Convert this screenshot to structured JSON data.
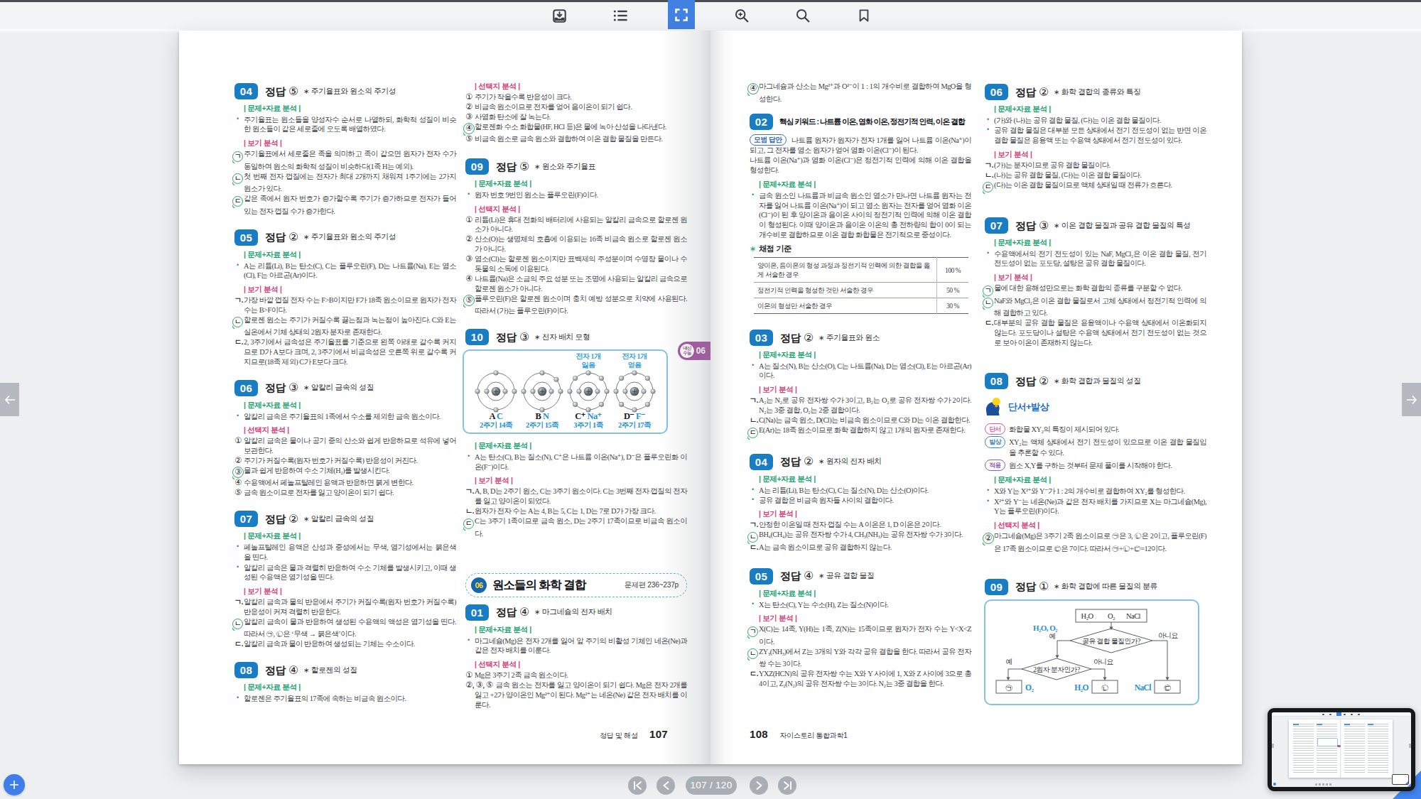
{
  "glyphs": {
    "star": "∗",
    "bullet": "•",
    "plus": "+",
    "left_arrow": "←",
    "right_arrow": "→",
    "pipe": "|"
  },
  "labels": {
    "answer": "정답"
  },
  "toolbar": {
    "items": [
      {
        "name": "download",
        "active": false
      },
      {
        "name": "toc",
        "active": false
      },
      {
        "name": "fullscreen",
        "active": true
      },
      {
        "name": "zoom-in",
        "active": false
      },
      {
        "name": "search",
        "active": false
      },
      {
        "name": "bookmark",
        "active": false
      }
    ]
  },
  "nav": {
    "indicator": "107 / 120",
    "buttons": [
      "first-page",
      "prev-page",
      "next-page",
      "last-page"
    ]
  },
  "left_page": {
    "footer": {
      "label": "정답 및 해설",
      "page": "107"
    },
    "sidetab": {
      "circle": [
        "내신",
        "수능"
      ],
      "num": "06"
    },
    "columns": [
      [
        {
          "type": "item",
          "num": "04",
          "ans": "⑤",
          "topic": "주기율표와 원소의 주기성",
          "blocks": [
            {
              "t": "g",
              "x": "문제+자료 분석"
            },
            {
              "t": "b",
              "x": "주기율표는 원소들을 양성자수 순서로 나열하되, 화학적 성질이 비슷한 원소들이 같은 세로줄에 오도록 배열하였다."
            },
            {
              "t": "p",
              "x": "보기 분석"
            },
            {
              "t": "m",
              "k": "ㄱ",
              "c": true,
              "x": "주기율표에서 세로줄은 족을 의미하고 족이 같으면 원자가 전자 수가 동일하여 원소의 화학적 성질이 비슷하다(1족 H는 예외)."
            },
            {
              "t": "m",
              "k": "ㄴ",
              "c": true,
              "x": "첫 번째 전자 껍질에는 전자가 최대 2개까지 채워져 1주기에는 2가지 원소가 있다."
            },
            {
              "t": "m",
              "k": "ㄷ",
              "c": true,
              "x": "같은 족에서 원자 번호가 증가할수록 주기가 증가하므로 전자가 들어 있는 전자 껍질 수가 증가한다."
            }
          ]
        },
        {
          "type": "item",
          "num": "05",
          "ans": "②",
          "topic": "주기율표와 원소의 주기성",
          "blocks": [
            {
              "t": "g",
              "x": "문제+자료 분석"
            },
            {
              "t": "b",
              "x": "A는 리튬(Li), B는 탄소(C), C는 플루오린(F), D는 나트륨(Na), E는 염소(Cl), F는 아르곤(Ar)이다."
            },
            {
              "t": "p",
              "x": "보기 분석"
            },
            {
              "t": "m",
              "k": "ㄱ",
              "c": false,
              "x": "가장 바깥 껍질 전자 수는 F>B이지만 F가 18족 원소이므로 원자가 전자 수는 B>F이다."
            },
            {
              "t": "m",
              "k": "ㄴ",
              "c": true,
              "x": "할로젠 원소는 주기가 커질수록 끓는점과 녹는점이 높아진다. C와 E는 실온에서 기체 상태의 2원자 분자로 존재한다."
            },
            {
              "t": "m",
              "k": "ㄷ",
              "c": false,
              "x": "2, 3주기에서 금속성은 주기율표를 기준으로 왼쪽 아래로 갈수록 커지므로 D가 A보다 크며, 2, 3주기에서 비금속성은 오른쪽 위로 갈수록 커지므로(18족 제외) C가 E보다 크다."
            }
          ]
        },
        {
          "type": "item",
          "num": "06",
          "ans": "③",
          "topic": "알칼리 금속의 성질",
          "blocks": [
            {
              "t": "g",
              "x": "문제+자료 분석"
            },
            {
              "t": "b",
              "x": "알칼리 금속은 주기율표의 1족에서 수소를 제외한 금속 원소이다."
            },
            {
              "t": "p",
              "x": "선택지 분석"
            },
            {
              "t": "m",
              "k": "①",
              "c": false,
              "x": "알칼리 금속은 물이나 공기 중의 산소와 쉽게 반응하므로 석유에 넣어 보관한다."
            },
            {
              "t": "m",
              "k": "②",
              "c": false,
              "x": "주기가 커질수록(원자 번호가 커질수록) 반응성이 커진다."
            },
            {
              "t": "m",
              "k": "③",
              "c": true,
              "x": "물과 쉽게 반응하여 수소 기체(H₂)를 발생시킨다."
            },
            {
              "t": "m",
              "k": "④",
              "c": false,
              "x": "수용액에서 페놀프탈레인 용액과 반응하면 붉게 변한다."
            },
            {
              "t": "m",
              "k": "⑤",
              "c": false,
              "x": "금속 원소이므로 전자를 잃고 양이온이 되기 쉽다."
            }
          ]
        },
        {
          "type": "item",
          "num": "07",
          "ans": "②",
          "topic": "알칼리 금속의 성질",
          "blocks": [
            {
              "t": "g",
              "x": "문제+자료 분석"
            },
            {
              "t": "b",
              "x": "페놀프탈레인 용액은 산성과 중성에서는 무색, 염기성에서는 붉은색을 띤다."
            },
            {
              "t": "b",
              "x": "알칼리 금속은 물과 격렬히 반응하여 수소 기체를 발생시키고, 이때 생성된 수용액은 염기성을 띤다."
            },
            {
              "t": "p",
              "x": "보기 분석"
            },
            {
              "t": "m",
              "k": "ㄱ",
              "c": false,
              "x": "알칼리 금속과 물의 반응에서 주기가 커질수록(원자 번호가 커질수록) 반응성이 커져 격렬히 반응한다."
            },
            {
              "t": "m",
              "k": "ㄴ",
              "c": true,
              "x": "알칼리 금속이 물과 반응하여 생성된 수용액의 액성은 염기성을 띤다. 따라서 ㉠, ㉡은 ‘무색 → 붉은색’이다."
            },
            {
              "t": "m",
              "k": "ㄷ",
              "c": false,
              "x": "알칼리 금속과 물이 반응하여 생성되는 기체는 수소이다."
            }
          ]
        },
        {
          "type": "item",
          "num": "08",
          "ans": "④",
          "topic": "할로젠의 성질",
          "blocks": [
            {
              "t": "g",
              "x": "문제+자료 분석"
            },
            {
              "t": "b",
              "x": "할로젠은 주기율표의 17족에 속하는 비금속 원소이다."
            }
          ]
        }
      ],
      [
        {
          "type": "cont",
          "blocks": [
            {
              "t": "p",
              "x": "선택지 분석"
            },
            {
              "t": "m",
              "k": "①",
              "c": false,
              "x": "주기가 작을수록 반응성이 크다."
            },
            {
              "t": "m",
              "k": "②",
              "c": false,
              "x": "비금속 원소이므로 전자를 얻어 음이온이 되기 쉽다."
            },
            {
              "t": "m",
              "k": "③",
              "c": false,
              "x": "사염화 탄소에 잘 녹는다."
            },
            {
              "t": "m",
              "k": "④",
              "c": true,
              "x": "할로젠화 수소 화합물(HF, HCl 등)은 물에 녹아 산성을 나타낸다."
            },
            {
              "t": "m",
              "k": "⑤",
              "c": false,
              "x": "비금속 원소로 금속 원소와 결합하여 이온 결합 물질을 만든다."
            }
          ]
        },
        {
          "type": "item",
          "num": "09",
          "ans": "⑤",
          "topic": "원소와 주기율표",
          "blocks": [
            {
              "t": "g",
              "x": "문제+자료 분석"
            },
            {
              "t": "b",
              "x": "원자 번호 9번인 원소는 플루오린(F)이다."
            },
            {
              "t": "p",
              "x": "선택지 분석"
            },
            {
              "t": "m",
              "k": "①",
              "c": false,
              "x": "리튬(Li)은 휴대 전화의 배터리에 사용되는 알칼리 금속으로 할로젠 원소가 아니다."
            },
            {
              "t": "m",
              "k": "②",
              "c": false,
              "x": "산소(O)는 생명체의 호흡에 이용되는 16족 비금속 원소로 할로젠 원소가 아니다."
            },
            {
              "t": "m",
              "k": "③",
              "c": false,
              "x": "염소(Cl)는 할로젠 원소이지만 표백제의 주성분이며 수영장 물이나 수돗물의 소독에 이용된다."
            },
            {
              "t": "m",
              "k": "④",
              "c": false,
              "x": "나트륨(Na)은 소금의 주요 성분 또는 조명에 사용되는 알칼리 금속으로 할로젠 원소가 아니다."
            },
            {
              "t": "m",
              "k": "⑤",
              "c": true,
              "x": "플루오린(F)은 할로젠 원소이며 충치 예방 성분으로 치약에 사용된다. 따라서 (가)는 플루오린(F)이다."
            }
          ]
        },
        {
          "type": "item",
          "num": "10",
          "ans": "③",
          "topic": "전자 배치 모형",
          "blocks": [
            {
              "t": "atoms",
              "atoms": [
                {
                  "name": "A",
                  "elem": "C",
                  "pos": "2주기 14족",
                  "inner": 2,
                  "outer": 4,
                  "above": []
                },
                {
                  "name": "B",
                  "elem": "N",
                  "pos": "2주기 15족",
                  "inner": 2,
                  "outer": 5,
                  "above": []
                },
                {
                  "name": "C⁺",
                  "elem": "Na⁺",
                  "pos": "3주기 1족",
                  "inner": 2,
                  "outer": 8,
                  "above": [
                    "전자 1개",
                    "잃음"
                  ]
                },
                {
                  "name": "D⁻",
                  "elem": "F⁻",
                  "pos": "2주기 17족",
                  "inner": 2,
                  "outer": 8,
                  "above": [
                    "전자 1개",
                    "얻음"
                  ]
                }
              ]
            },
            {
              "t": "g",
              "x": "문제+자료 분석"
            },
            {
              "t": "b",
              "x": "A는 탄소(C), B는 질소(N), C⁺은 나트륨 이온(Na⁺), D⁻은 플루오린화 이온(F⁻)이다."
            },
            {
              "t": "p",
              "x": "보기 분석"
            },
            {
              "t": "m",
              "k": "ㄱ",
              "c": false,
              "x": "A, B, D는 2주기 원소, C는 3주기 원소이다. C는 3번째 전자 껍질의 전자를 잃고 양이온이 되었다."
            },
            {
              "t": "m",
              "k": "ㄴ",
              "c": false,
              "x": "원자가 전자 수는 A는 4, B는 5, C는 1, D는 7로 D가 가장 크다."
            },
            {
              "t": "m",
              "k": "ㄷ",
              "c": true,
              "x": "C는 3주기 1족이므로 금속 원소, D는 2주기 17족이므로 비금속 원소이다."
            }
          ]
        },
        {
          "type": "sect",
          "badge": "06",
          "title": "원소들의 화학 결합",
          "pages": "문제편 236~237p"
        },
        {
          "type": "item",
          "num": "01",
          "ans": "④",
          "topic": "마그네슘의 전자 배치",
          "blocks": [
            {
              "t": "g",
              "x": "문제+자료 분석"
            },
            {
              "t": "b",
              "x": "마그네슘(Mg)은 전자 2개를 잃어 앞 주기의 비활성 기체인 네온(Ne)과 같은 전자 배치를 이룬다."
            },
            {
              "t": "p",
              "x": "선택지 분석"
            },
            {
              "t": "m",
              "k": "①",
              "c": false,
              "x": "Mg은 3주기 2족 금속 원소이다."
            },
            {
              "t": "m",
              "k": "②, ③, ⑤",
              "c": false,
              "x": "금속 원소는 전자를 잃고 양이온이 되기 쉽다. Mg은 전자 2개를 잃고 +2가 양이온인 Mg²⁺이 된다. Mg²⁺는 네온(Ne) 같은 전자 배치를 이룬다."
            }
          ]
        }
      ]
    ]
  },
  "right_page": {
    "footer": {
      "page": "108",
      "label": "자이스토리 통합과학1"
    },
    "columns": [
      [
        {
          "type": "cont",
          "blocks": [
            {
              "t": "m",
              "k": "④",
              "c": true,
              "x": "마그네슘과 산소는 Mg²⁺과 O²⁻이 1 : 1의 개수비로 결합하여 MgO을 형성한다."
            }
          ]
        },
        {
          "type": "item",
          "num": "02",
          "kw": "핵심 키워드 : 나트륨 이온, 염화 이온, 정전기적 인력, 이온 결합",
          "blocks": [
            {
              "t": "ma",
              "badge": "모범 답안",
              "x": [
                "나트륨 원자가 원자가 전자 1개를 잃어 나트륨 이온(Na⁺)이 되고, 그 전자를 염소 원자가 얻어 염화 이온(Cl⁻)이 된다.",
                "나트륨 이온(Na⁺)과 염화 이온(Cl⁻)은 정전기적 인력에 의해 이온 결합을 형성한다."
              ]
            },
            {
              "t": "g",
              "x": "문제+자료 분석"
            },
            {
              "t": "b",
              "x": "금속 원소인 나트륨과 비금속 원소인 염소가 만나면 나트륨 원자는 전자를 잃어 나트륨 이온(Na⁺)이 되고 염소 원자는 전자를 얻어 염화 이온(Cl⁻)이 된 후 양이온과 음이온 사이의 정전기적 인력에 의해 이온 결합이 형성된다. 이때 양이온과 음이온 이온의 총 전하량의 합이 0이 되는 개수비로 결합하므로 이온 결합 화합물은 전기적으로 중성이다."
            },
            {
              "t": "tb",
              "title": "채점 기준",
              "rows": [
                {
                  "x": "양이온, 음이온의 형성 과정과 정전기적 인력에 의한 결합을 옳게 서술한 경우",
                  "v": "100 %"
                },
                {
                  "x": "정전기적 인력을 형성한 것만 서술한 경우",
                  "v": "50 %"
                },
                {
                  "x": "이온의 형성만 서술한 경우",
                  "v": "30 %"
                }
              ]
            }
          ]
        },
        {
          "type": "item",
          "num": "03",
          "ans": "②",
          "topic": "주기율표와 원소",
          "blocks": [
            {
              "t": "g",
              "x": "문제+자료 분석"
            },
            {
              "t": "b",
              "x": "A는 질소(N), B는 산소(O), C는 나트륨(Na), D는 염소(Cl), E는 아르곤(Ar)이다."
            },
            {
              "t": "p",
              "x": "보기 분석"
            },
            {
              "t": "m",
              "k": "ㄱ",
              "c": false,
              "x": "A₂는 N₂로 공유 전자쌍 수가 3이고, B₂는 O₂로 공유 전자쌍 수가 2이다. N₂는 3중 결합, O₂는 2중 결합이다."
            },
            {
              "t": "m",
              "k": "ㄴ",
              "c": false,
              "x": "C(Na)는 금속 원소, D(Cl)는 비금속 원소이므로 C와 D는 이온 결합한다."
            },
            {
              "t": "m",
              "k": "ㄷ",
              "c": true,
              "x": "E(Ar)는 18족 원소이므로 화학 결합하지 않고 1개의 원자로 존재한다."
            }
          ]
        },
        {
          "type": "item",
          "num": "04",
          "ans": "②",
          "topic": "원자의 전자 배치",
          "blocks": [
            {
              "t": "g",
              "x": "문제+자료 분석"
            },
            {
              "t": "b",
              "x": "A는 리튬(Li), B는 탄소(C), C는 질소(N), D는 산소(O)이다."
            },
            {
              "t": "b",
              "x": "공유 결합은 비금속 원자들 사이의 결합이다."
            },
            {
              "t": "p",
              "x": "보기 분석"
            },
            {
              "t": "m",
              "k": "ㄱ",
              "c": false,
              "x": "안정한 이온일 때 전자 껍질 수는 A 이온은 1, D 이온은 2이다."
            },
            {
              "t": "m",
              "k": "ㄴ",
              "c": true,
              "x": "BH₄(CH₄)는 공유 전자쌍 수가 4, CH₃(NH₃)는 공유 전자쌍 수가 3이다."
            },
            {
              "t": "m",
              "k": "ㄷ",
              "c": false,
              "x": "A는 금속 원소이므로 공유 결합하지 않는다."
            }
          ]
        },
        {
          "type": "item",
          "num": "05",
          "ans": "④",
          "topic": "공유 결합 물질",
          "blocks": [
            {
              "t": "g",
              "x": "문제+자료 분석"
            },
            {
              "t": "b",
              "x": "X는 탄소(C), Y는 수소(H), Z는 질소(N)이다."
            },
            {
              "t": "p",
              "x": "보기 분석"
            },
            {
              "t": "m",
              "k": "ㄱ",
              "c": true,
              "x": "X(C)는 14족, Y(H)는 1족, Z(N)는 15족이므로 원자가 전자 수는 Y<X<Z이다."
            },
            {
              "t": "m",
              "k": "ㄴ",
              "c": true,
              "x": "ZY₃(NH₃)에서 Z는 3개의 Y와 각각 공유 결합을 한다. 따라서 공유 전자쌍 수는 3이다."
            },
            {
              "t": "m",
              "k": "ㄷ",
              "c": false,
              "x": "YXZ(HCN)의 공유 전자쌍 수는 X와 Y 사이에 1, X와 Z 사이에 3으로 총 4이고, Z₂(N₂)의 공유 전자쌍 수는 3이다. N₂는 3중 결합을 한다."
            }
          ]
        }
      ],
      [
        {
          "type": "item",
          "num": "06",
          "ans": "②",
          "topic": "화학 결합의 종류와 특징",
          "blocks": [
            {
              "t": "g",
              "x": "문제+자료 분석"
            },
            {
              "t": "b",
              "x": "(가)와 (나)는 공유 결합 물질, (다)는 이온 결합 물질이다."
            },
            {
              "t": "b",
              "x": "공유 결합 물질은 대부분 모든 상태에서 전기 전도성이 없는 반면 이온 결합 물질은 용융액 또는 수용액 상태에서 전기 전도성이 있다."
            },
            {
              "t": "p",
              "x": "보기 분석"
            },
            {
              "t": "m",
              "k": "ㄱ",
              "c": false,
              "x": "(가)는 분자이므로 공유 결합 물질이다."
            },
            {
              "t": "m",
              "k": "ㄴ",
              "c": false,
              "x": "(나)는 공유 결합 물질, (다)는 이온 결합 물질이다."
            },
            {
              "t": "m",
              "k": "ㄷ",
              "c": true,
              "x": "(다)는 이온 결합 물질이므로 액체 상태일 때 전류가 흐른다."
            }
          ]
        },
        {
          "type": "item",
          "num": "07",
          "ans": "③",
          "topic": "이온 결합 물질과 공유 결합 물질의 특성",
          "blocks": [
            {
              "t": "g",
              "x": "문제+자료 분석"
            },
            {
              "t": "b",
              "x": "수용액에서의 전기 전도성이 있는 NaF, MgCl₂은 이온 결합 물질, 전기 전도성이 없는 포도당, 설탕은 공유 결합 물질이다."
            },
            {
              "t": "p",
              "x": "보기 분석"
            },
            {
              "t": "m",
              "k": "ㄱ",
              "c": true,
              "x": "물에 대한 용해성만으로는 화학 결합의 종류를 구분할 수 없다."
            },
            {
              "t": "m",
              "k": "ㄴ",
              "c": true,
              "x": "NaF와 MgCl₂은 이온 결합 물질로서 고체 상태에서 정전기적 인력에 의해 결합하고 있다."
            },
            {
              "t": "m",
              "k": "ㄷ",
              "c": false,
              "x": "대부분의 공유 결합 물질은 용융액이나 수용액 상태에서 이온화되지 않는다. 포도당이나 설탕은 수용액 상태에서 전기 전도성이 없는 것으로 보아 이온이 존재하지 않는다."
            }
          ]
        },
        {
          "type": "item",
          "num": "08",
          "ans": "②",
          "topic": "화학 결합과 물질의 성질",
          "blocks": [
            {
              "t": "clue",
              "label": "단서+발상"
            },
            {
              "t": "tag",
              "k": "단서",
              "cl": "pk",
              "x": "화합물 XY₂의 특징이 제시되어 있다."
            },
            {
              "t": "tag",
              "k": "발상",
              "cl": "bl",
              "x": "XY₂는 액체 상태에서 전기 전도성이 있으므로 이온 결합 물질임을 추론할 수 있다."
            },
            {
              "t": "tag",
              "k": "적용",
              "cl": "pu",
              "x": "원소 X,Y를 구하는 것부터 문제 풀이를 시작해야 한다."
            },
            {
              "t": "g",
              "x": "문제+자료 분석"
            },
            {
              "t": "b",
              "x": "X와 Y는 X²⁺와 Y⁻가 1 : 2의 개수비로 결합하여 XY₂를 형성한다."
            },
            {
              "t": "b",
              "x": "X²⁺와 Y⁻는 네온(Ne)과 같은 전자 배치를 가지므로 X는 마그네슘(Mg), Y는 플루오린(F)이다."
            },
            {
              "t": "p",
              "x": "선택지 분석"
            },
            {
              "t": "m",
              "k": "②",
              "c": true,
              "x": "마그네슘(Mg)은 3주기 2족 원소이므로 ㉠은 3, ㉡은 2이고, 플루오린(F)은 17족 원소이므로 ㉢은 7이다. 따라서 ㉠+㉡+㉢=12이다."
            }
          ]
        },
        {
          "type": "item",
          "num": "09",
          "ans": "①",
          "topic": "화학 결합에 따른 물질의 분류",
          "blocks": [
            {
              "t": "flow",
              "top": [
                "H₂O",
                "O₂",
                "NaCl"
              ],
              "q1": "공유 결합 물질인가?",
              "q2": "2원자 분자인가?",
              "yes": "예",
              "no": "아니요",
              "branch": "H₂O, O₂",
              "out1": "㉠",
              "out1_label": "O₂",
              "out2": "㉡",
              "out2_label": "H₂O",
              "out3": "㉢",
              "out3_label": "NaCl"
            }
          ]
        }
      ]
    ]
  }
}
